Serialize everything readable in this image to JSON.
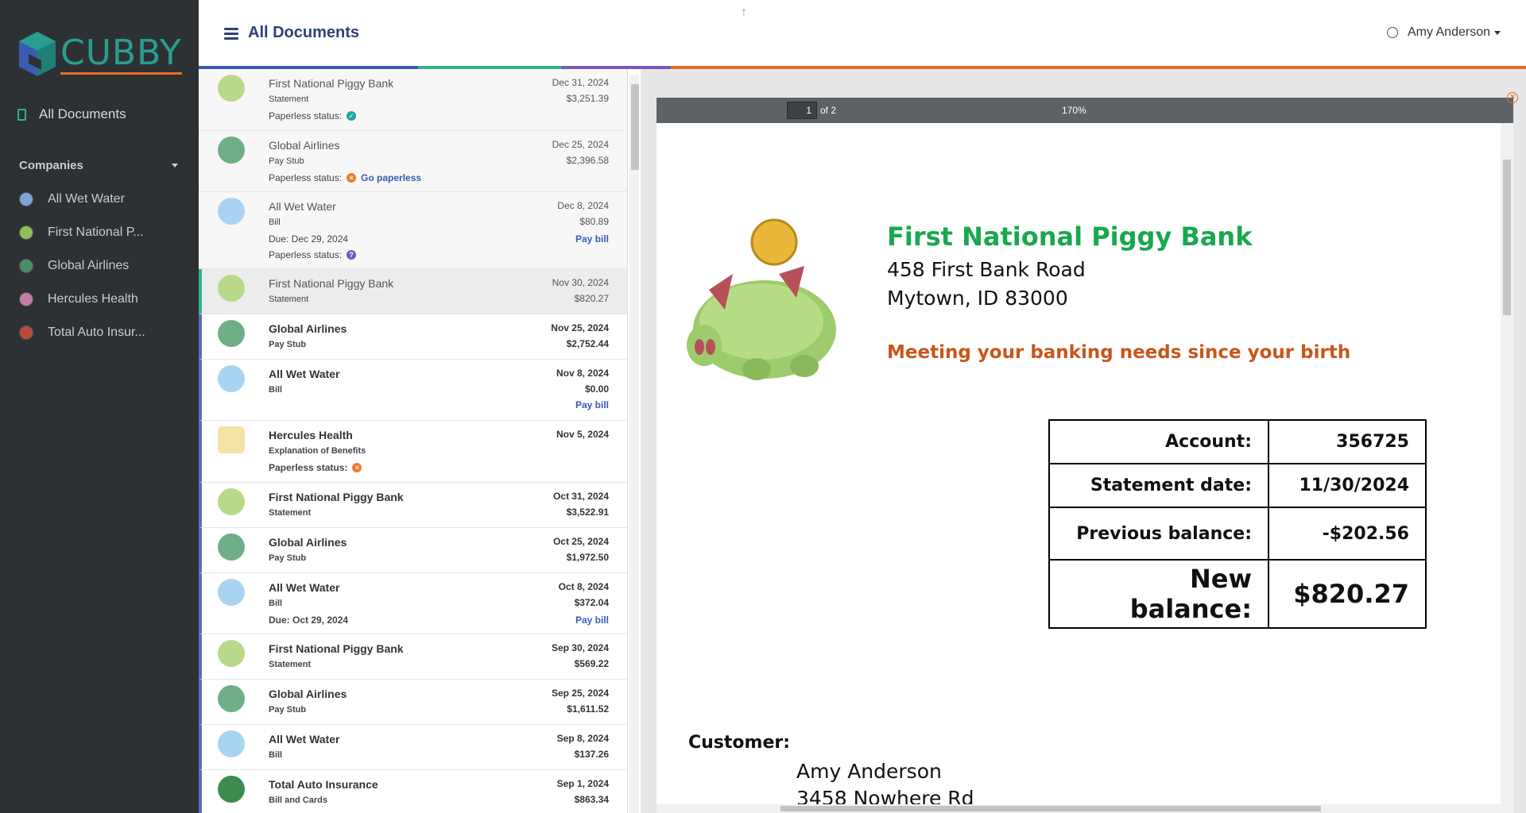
{
  "app": {
    "brand": "CUBBY"
  },
  "sidebar": {
    "all_documents": "All Documents",
    "companies_label": "Companies",
    "companies": [
      {
        "label": "All Wet Water"
      },
      {
        "label": "First National P..."
      },
      {
        "label": "Global Airlines"
      },
      {
        "label": "Hercules Health"
      },
      {
        "label": "Total Auto Insur..."
      }
    ]
  },
  "header": {
    "title": "All Documents",
    "user": "Amy Anderson"
  },
  "documents": [
    {
      "company": "First National Piggy Bank",
      "type": "Statement",
      "date": "Dec 31, 2024",
      "amount": "$3,251.39",
      "status_label": "Paperless status:"
    },
    {
      "company": "Global Airlines",
      "type": "Pay Stub",
      "date": "Dec 25, 2024",
      "amount": "$2,396.58",
      "status_label": "Paperless status:",
      "action": "Go paperless"
    },
    {
      "company": "All Wet Water",
      "type": "Bill",
      "date": "Dec 8, 2024",
      "amount": "$80.89",
      "due": "Due: Dec 29, 2024",
      "pay": "Pay bill",
      "status_label": "Paperless status:"
    },
    {
      "company": "First National Piggy Bank",
      "type": "Statement",
      "date": "Nov 30, 2024",
      "amount": "$820.27"
    },
    {
      "company": "Global Airlines",
      "type": "Pay Stub",
      "date": "Nov 25, 2024",
      "amount": "$2,752.44"
    },
    {
      "company": "All Wet Water",
      "type": "Bill",
      "date": "Nov 8, 2024",
      "amount": "$0.00",
      "pay": "Pay bill"
    },
    {
      "company": "Hercules Health",
      "type": "Explanation of Benefits",
      "date": "Nov 5, 2024",
      "status_label": "Paperless status:"
    },
    {
      "company": "First National Piggy Bank",
      "type": "Statement",
      "date": "Oct 31, 2024",
      "amount": "$3,522.91"
    },
    {
      "company": "Global Airlines",
      "type": "Pay Stub",
      "date": "Oct 25, 2024",
      "amount": "$1,972.50"
    },
    {
      "company": "All Wet Water",
      "type": "Bill",
      "date": "Oct 8, 2024",
      "amount": "$372.04",
      "due": "Due: Oct 29, 2024",
      "pay": "Pay bill"
    },
    {
      "company": "First National Piggy Bank",
      "type": "Statement",
      "date": "Sep 30, 2024",
      "amount": "$569.22"
    },
    {
      "company": "Global Airlines",
      "type": "Pay Stub",
      "date": "Sep 25, 2024",
      "amount": "$1,611.52"
    },
    {
      "company": "All Wet Water",
      "type": "Bill",
      "date": "Sep 8, 2024",
      "amount": "$137.26"
    },
    {
      "company": "Total Auto Insurance",
      "type": "Bill and Cards",
      "date": "Sep 1, 2024",
      "amount": "$863.34"
    }
  ],
  "viewer": {
    "page": "1",
    "page_total": "of 2",
    "zoom": "170%"
  },
  "statement": {
    "bank_name": "First National Piggy Bank",
    "address_line1": "458 First Bank Road",
    "address_line2": "Mytown, ID 83000",
    "tagline": "Meeting your banking needs since your birth",
    "rows": [
      {
        "label": "Account:",
        "value": "356725"
      },
      {
        "label": "Statement date:",
        "value": "11/30/2024"
      },
      {
        "label": "Previous balance:",
        "value": "-$202.56"
      },
      {
        "label": "New balance:",
        "value": "$820.27"
      }
    ],
    "customer_label": "Customer:",
    "customer_name": "Amy Anderson",
    "customer_address": "3458 Nowhere Rd"
  },
  "colors": {
    "sidebar_bg": "#2e3133",
    "accent_teal": "#2bb58f",
    "accent_navy": "#2f3f7e",
    "accent_orange": "#e46f24",
    "bank_green": "#18a84f",
    "tagline_orange": "#c8551b"
  }
}
